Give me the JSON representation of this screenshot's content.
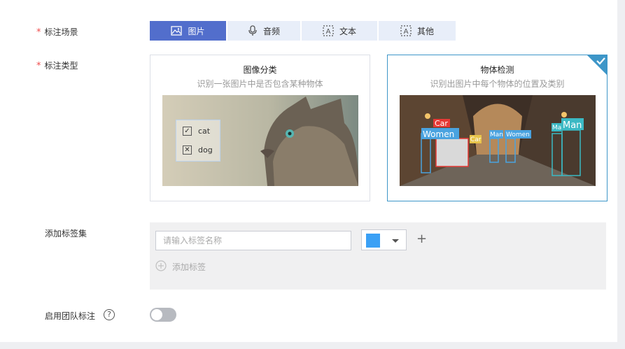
{
  "scene": {
    "label": "标注场景",
    "options": [
      {
        "label": "图片",
        "icon": "image-icon",
        "active": true
      },
      {
        "label": "音频",
        "icon": "microphone-icon",
        "active": false
      },
      {
        "label": "文本",
        "icon": "text-icon",
        "active": false
      },
      {
        "label": "其他",
        "icon": "text-icon",
        "active": false
      }
    ]
  },
  "type": {
    "label": "标注类型",
    "cards": [
      {
        "title": "图像分类",
        "desc": "识别一张图片中是否包含某种物体",
        "selected": false,
        "overlay": {
          "items": [
            {
              "label": "cat",
              "state": "checked"
            },
            {
              "label": "dog",
              "state": "crossed"
            }
          ]
        }
      },
      {
        "title": "物体检测",
        "desc": "识别出图片中每个物体的位置及类别",
        "selected": true,
        "boxes": [
          "Car",
          "Women",
          "Man",
          "Women",
          "Car",
          "Ma",
          "Man"
        ]
      }
    ]
  },
  "tagset": {
    "label": "添加标签集",
    "input_placeholder": "请输入标签名称",
    "color": "#3aa0f5",
    "add_label": "添加标签"
  },
  "team": {
    "label": "启用团队标注",
    "help": "?",
    "enabled": false
  },
  "colors": {
    "accent": "#526ecc",
    "required": "#ef4d4d",
    "selected_border": "#3d96c8"
  }
}
